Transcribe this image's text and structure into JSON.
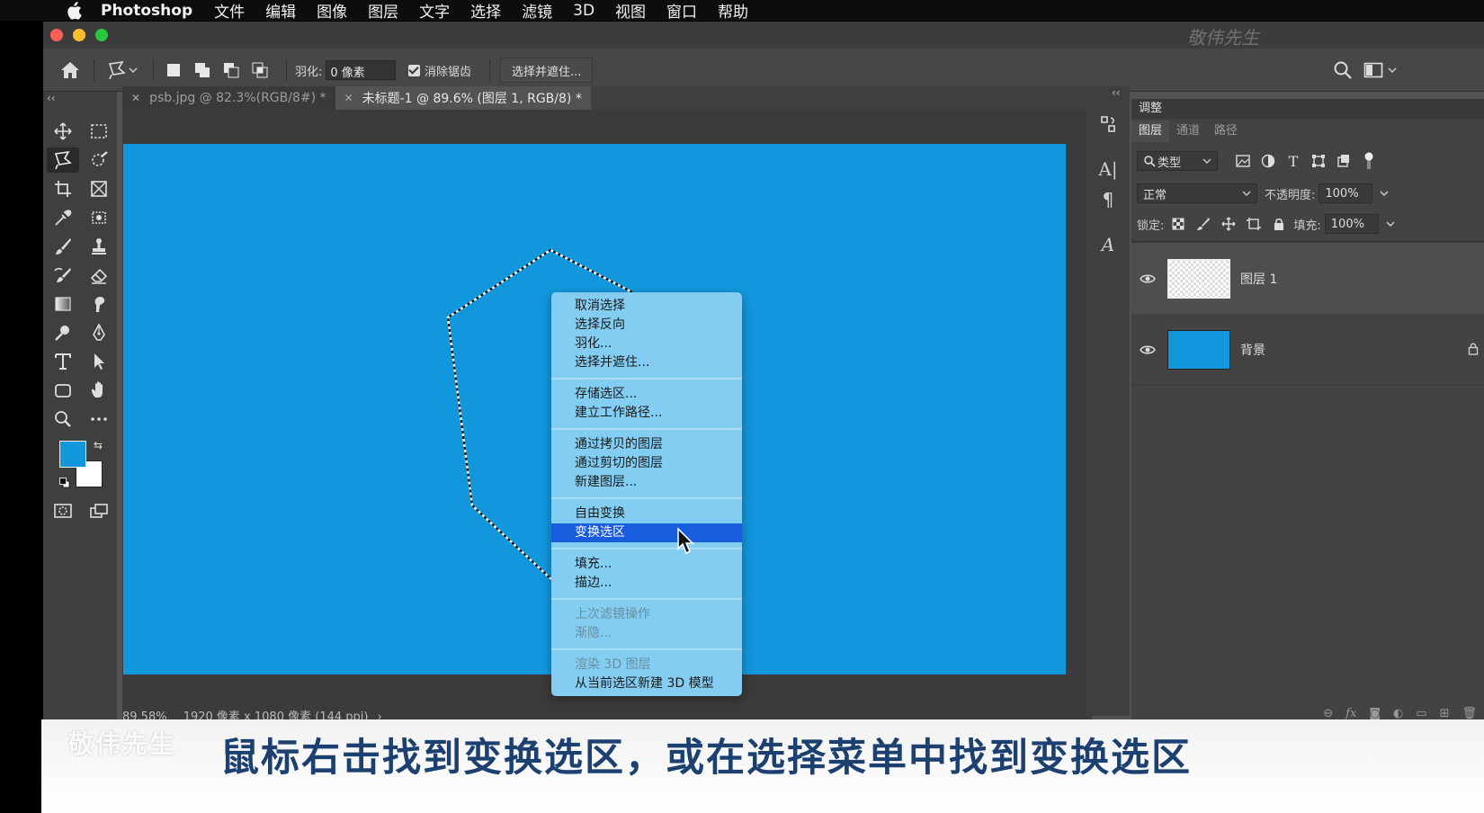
{
  "menubar": {
    "app": "Photoshop",
    "items": [
      "文件",
      "编辑",
      "图像",
      "图层",
      "文字",
      "选择",
      "滤镜",
      "3D",
      "视图",
      "窗口",
      "帮助"
    ]
  },
  "window": {
    "watermark": "敬伟先生"
  },
  "options_bar": {
    "feather_label": "羽化:",
    "feather_value": "0 像素",
    "antialias_label": "消除锯齿",
    "select_mask_button": "选择并遮住..."
  },
  "tabs": [
    {
      "title": "psb.jpg @ 82.3%(RGB/8#) *",
      "active": false
    },
    {
      "title": "未标题-1 @ 89.6% (图层 1, RGB/8) *",
      "active": true
    }
  ],
  "context_menu": {
    "groups": [
      [
        "取消选择",
        "选择反向",
        "羽化...",
        "选择并遮住..."
      ],
      [
        "存储选区...",
        "建立工作路径..."
      ],
      [
        "通过拷贝的图层",
        "通过剪切的图层",
        "新建图层..."
      ],
      [
        "自由变换",
        "变换选区"
      ],
      [
        "填充...",
        "描边..."
      ],
      [
        "上次滤镜操作",
        "渐隐..."
      ],
      [
        "渲染 3D 图层",
        "从当前选区新建 3D 模型"
      ]
    ],
    "highlighted": "变换选区",
    "disabled": [
      "上次滤镜操作",
      "渐隐...",
      "渲染 3D 图层"
    ]
  },
  "status_bar": {
    "zoom": "89.58%",
    "doc_info": "1920 像素 x 1080 像素 (144 ppi)"
  },
  "panels": {
    "adjust_title": "调整",
    "tabs": [
      "图层",
      "通道",
      "路径"
    ],
    "filter_kind": "类型",
    "blend_mode": "正常",
    "opacity_label": "不透明度:",
    "opacity_value": "100%",
    "lock_label": "锁定:",
    "fill_label": "填充:",
    "fill_value": "100%",
    "layers": [
      {
        "name": "图层 1",
        "selected": true
      },
      {
        "name": "背景",
        "selected": false,
        "locked": true
      }
    ]
  },
  "colors": {
    "foreground": "#1397dc",
    "background": "#ffffff",
    "canvas": "#1397dc",
    "menu_bg": "#83cdf2",
    "menu_highlight": "#1a5cde"
  },
  "subtitle": {
    "logo": "敬伟先生",
    "text": "鼠标右击找到变换选区，或在选择菜单中找到变换选区"
  }
}
